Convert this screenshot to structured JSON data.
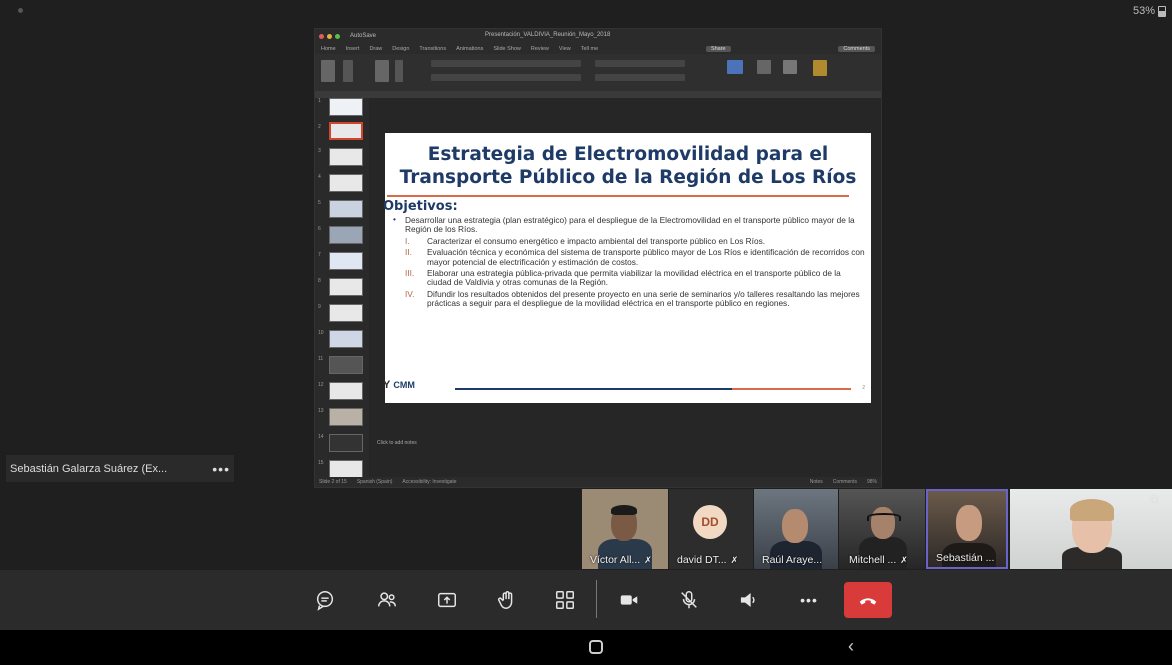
{
  "status": {
    "battery": "53%"
  },
  "ppt": {
    "window_title": "Presentación_VALDIVIA_Reunión_Mayo_2018",
    "menu": [
      "Home",
      "Insert",
      "Draw",
      "Design",
      "Transitions",
      "Animations",
      "Slide Show",
      "Review",
      "View",
      "Tell me"
    ],
    "share_label": "Share",
    "comments_label": "Comments",
    "notes_placeholder": "Click to add notes",
    "status_left": "Slide 2 of 15",
    "status_lang": "Spanish (Spain)",
    "status_access": "Accessibility: Investigate",
    "status_notes": "Notes",
    "status_comments": "Comments",
    "status_zoom": "98%",
    "thumb_numbers": [
      "1",
      "2",
      "3",
      "4",
      "5",
      "6",
      "7",
      "8",
      "9",
      "10",
      "11",
      "12",
      "13",
      "14",
      "15"
    ]
  },
  "slide": {
    "title_line1": "Estrategia de Electromovilidad para el",
    "title_line2": "Transporte Público de la Región de Los Ríos",
    "objectives_heading": "Objetivos:",
    "main_bullet": "Desarrollar una estrategia (plan estratégico) para el despliegue de la Electromovilidad en el transporte público mayor de la Región de los Ríos.",
    "items": [
      {
        "num": "I.",
        "text": "Caracterizar el consumo energético e impacto ambiental del transporte público en Los Ríos."
      },
      {
        "num": "II.",
        "text": "Evaluación técnica y económica del sistema de transporte público mayor de Los Ríos e identificación de recorridos con mayor potencial de electrificación y estimación de costos."
      },
      {
        "num": "III.",
        "text": "Elaborar una estrategia pública-privada que permita viabilizar la movilidad eléctrica en el transporte público de la ciudad de Valdivia y otras comunas de la Región."
      },
      {
        "num": "IV.",
        "text": "Difundir los resultados obtenidos del presente proyecto en una serie de seminarios y/o talleres resaltando las mejores prácticas a seguir para el despliegue de la movilidad eléctrica en el transporte público en regiones."
      }
    ],
    "logo_text": "CMM",
    "page_number": "2"
  },
  "sidebar_participant": {
    "name": "Sebastián Galarza Suárez (Ex...",
    "more": "•••"
  },
  "participants": [
    {
      "label": "Víctor All..."
    },
    {
      "label": "david DT...",
      "initials": "DD"
    },
    {
      "label": "Raúl Araye..."
    },
    {
      "label": "Mitchell ..."
    },
    {
      "label": "Sebastián ..."
    },
    {
      "label": ""
    }
  ],
  "controls": {
    "chat": "chat",
    "people": "participants",
    "share": "share-screen",
    "raise_hand": "raise-hand",
    "view": "view",
    "camera": "camera",
    "mic": "mic-off",
    "speaker": "speaker",
    "more": "more",
    "hangup": "hang-up"
  },
  "colors": {
    "slide_title": "#1e3a66",
    "accent": "#d96b4a",
    "hangup": "#d93a3a",
    "active_speaker_border": "#6b64c8"
  }
}
